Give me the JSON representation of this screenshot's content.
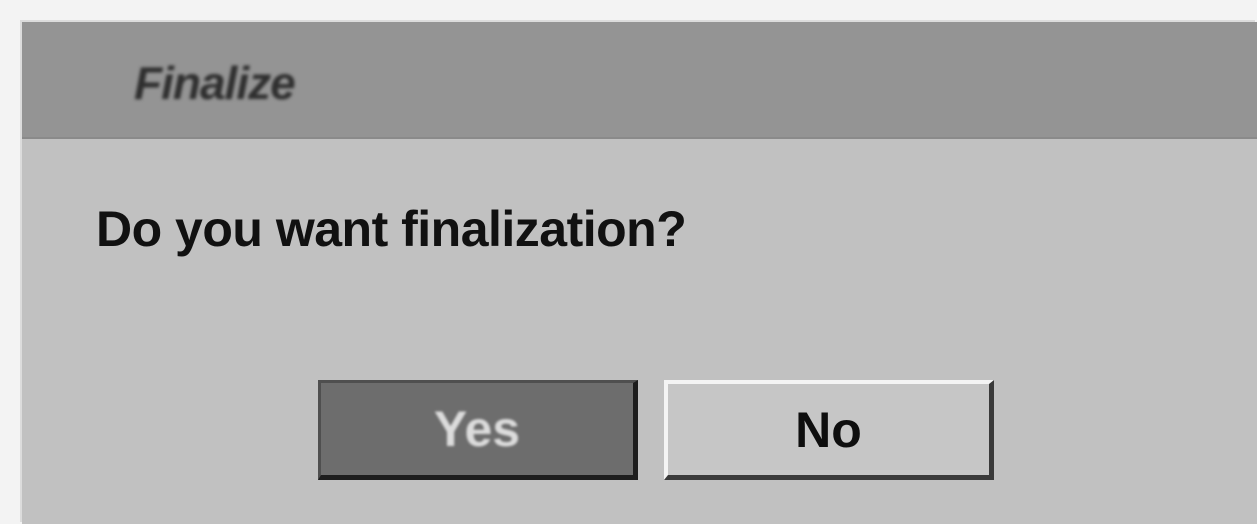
{
  "dialog": {
    "title": "Finalize",
    "message": "Do you want finalization?",
    "buttons": {
      "yes_label": "Yes",
      "no_label": "No"
    },
    "selected_button": "Yes"
  }
}
